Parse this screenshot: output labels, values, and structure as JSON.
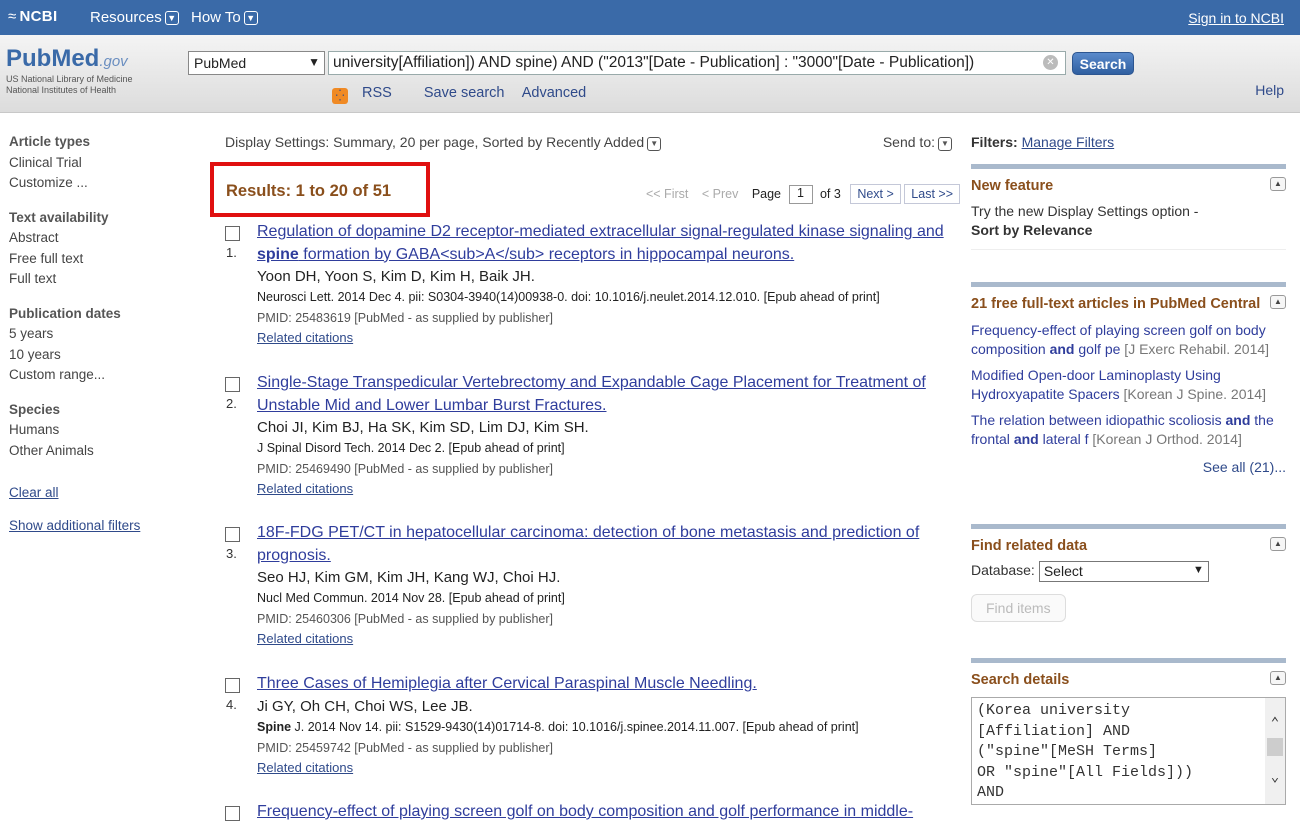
{
  "topbar": {
    "ncbi": "NCBI",
    "resources": "Resources",
    "howto": "How To",
    "signin": "Sign in to NCBI"
  },
  "header": {
    "logo_pub": "Pub",
    "logo_med": "Med",
    "logo_gov": ".gov",
    "nlm_line1": "US National Library of Medicine",
    "nlm_line2": "National Institutes of Health",
    "db_value": "PubMed",
    "query": "university[Affiliation]) AND spine) AND (\"2013\"[Date - Publication] : \"3000\"[Date - Publication])",
    "search_label": "Search",
    "rss": "RSS",
    "save_search": "Save search",
    "advanced": "Advanced",
    "help": "Help"
  },
  "sidebar": {
    "article_types": "Article types",
    "clinical_trial": "Clinical Trial",
    "customize": "Customize ...",
    "text_availability": "Text availability",
    "abstract": "Abstract",
    "free_full_text": "Free full text",
    "full_text": "Full text",
    "publication_dates": "Publication dates",
    "five_years": "5 years",
    "ten_years": "10 years",
    "custom_range": "Custom range...",
    "species": "Species",
    "humans": "Humans",
    "other_animals": "Other Animals",
    "clear_all": "Clear all",
    "show_additional": "Show additional filters"
  },
  "main": {
    "display_settings": "Display Settings: Summary, 20 per page, Sorted by Recently Added",
    "send_to": "Send to:",
    "results_count": "Results: 1 to 20 of 51",
    "pager": {
      "first": "<< First",
      "prev": "< Prev",
      "page": "Page",
      "current": "1",
      "of": "of 3",
      "next": "Next >",
      "last": "Last >>"
    },
    "results": [
      {
        "num": "1.",
        "title_a": "Regulation of dopamine D2 receptor-mediated extracellular signal-regulated kinase signaling and ",
        "title_bold": "spine",
        "title_b": " formation by GABA<sub>A</sub> receptors in hippocampal neurons.",
        "authors": "Yoon DH, Yoon S, Kim D, Kim H, Baik JH.",
        "journal_bold": "",
        "journal": "Neurosci Lett. 2014 Dec 4. pii: S0304-3940(14)00938-0. doi: 10.1016/j.neulet.2014.12.010. [Epub ahead of print]",
        "pmid": "PMID: 25483619 [PubMed - as supplied by publisher]",
        "related": "Related citations"
      },
      {
        "num": "2.",
        "title_a": "Single-Stage Transpedicular Vertebrectomy and Expandable Cage Placement for Treatment of Unstable Mid and Lower Lumbar Burst Fractures.",
        "title_bold": "",
        "title_b": "",
        "authors": "Choi JI, Kim BJ, Ha SK, Kim SD, Lim DJ, Kim SH.",
        "journal_bold": "",
        "journal": "J Spinal Disord Tech. 2014 Dec 2. [Epub ahead of print]",
        "pmid": "PMID: 25469490 [PubMed - as supplied by publisher]",
        "related": "Related citations"
      },
      {
        "num": "3.",
        "title_a": "18F-FDG PET/CT in hepatocellular carcinoma: detection of bone metastasis and prediction of prognosis.",
        "title_bold": "",
        "title_b": "",
        "authors": "Seo HJ, Kim GM, Kim JH, Kang WJ, Choi HJ.",
        "journal_bold": "",
        "journal": "Nucl Med Commun. 2014 Nov 28. [Epub ahead of print]",
        "pmid": "PMID: 25460306 [PubMed - as supplied by publisher]",
        "related": "Related citations"
      },
      {
        "num": "4.",
        "title_a": "Three Cases of Hemiplegia after Cervical Paraspinal Muscle Needling.",
        "title_bold": "",
        "title_b": "",
        "authors": "Ji GY, Oh CH, Choi WS, Lee JB.",
        "journal_bold": "Spine",
        "journal": " J. 2014 Nov 14. pii: S1529-9430(14)01714-8. doi: 10.1016/j.spinee.2014.11.007. [Epub ahead of print]",
        "pmid": "PMID: 25459742 [PubMed - as supplied by publisher]",
        "related": "Related citations"
      },
      {
        "num": "",
        "title_a": "Frequency-effect of playing screen golf on body composition and golf performance in middle-",
        "title_bold": "",
        "title_b": "",
        "authors": "",
        "journal_bold": "",
        "journal": "",
        "pmid": "",
        "related": ""
      }
    ]
  },
  "right": {
    "filters_label": "Filters:",
    "manage_filters": "Manage Filters",
    "new_feature": {
      "title": "New feature",
      "body": "Try the new Display Settings option -",
      "bold": "Sort by Relevance"
    },
    "free_fulltext": {
      "title": "21 free full-text articles in PubMed Central",
      "articles": [
        {
          "t1": "Frequency-effect of playing screen golf on body composition ",
          "and": "and",
          "t2": " golf pe",
          "src": " [J Exerc Rehabil. 2014]"
        },
        {
          "t1": "Modified Open-door Laminoplasty Using Hydroxyapatite Spacers",
          "and": "",
          "t2": "",
          "src": " [Korean J Spine. 2014]"
        },
        {
          "t1": "The relation between idiopathic scoliosis ",
          "and": "and",
          "t2": " the frontal ",
          "and2": "and",
          "t3": " lateral f",
          "src": " [Korean J Orthod. 2014]"
        }
      ],
      "see_all": "See all (21)..."
    },
    "related_data": {
      "title": "Find related data",
      "database_label": "Database:",
      "database_value": "Select",
      "find_items": "Find items"
    },
    "search_details": {
      "title": "Search details",
      "lines": [
        "(Korea university",
        "[Affiliation] AND",
        "(\"spine\"[MeSH Terms]",
        "OR \"spine\"[All Fields]))",
        "AND"
      ]
    }
  }
}
